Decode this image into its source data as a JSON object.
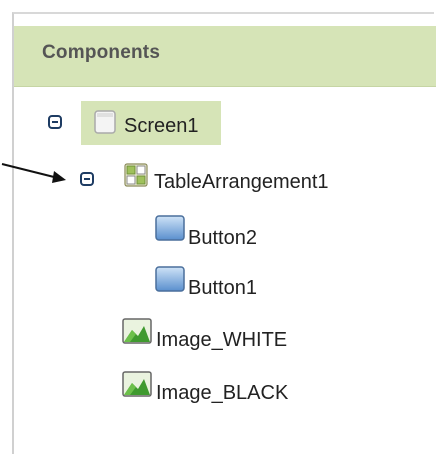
{
  "panel": {
    "title": "Components"
  },
  "tree": {
    "screen": {
      "label": "Screen1",
      "icon": "screen-icon",
      "selected": true
    },
    "table": {
      "label": "TableArrangement1",
      "icon": "table-arrangement-icon"
    },
    "button2": {
      "label": "Button2",
      "icon": "button-icon"
    },
    "button1": {
      "label": "Button1",
      "icon": "button-icon"
    },
    "image_white": {
      "label": "Image_WHITE",
      "icon": "image-icon"
    },
    "image_black": {
      "label": "Image_BLACK",
      "icon": "image-icon"
    }
  },
  "colors": {
    "header": "#d6e4b7",
    "selection": "#d6e4b7",
    "toggle": "#1e3c63"
  }
}
